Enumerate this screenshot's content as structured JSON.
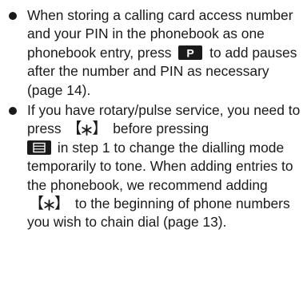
{
  "items": [
    {
      "parts": {
        "a": "When storing a calling card access number and your PIN in the phonebook as one phonebook entry, press",
        "b": "to add pauses after the number and PIN as necessary (page 14)."
      },
      "key_icon": "pause-key-icon",
      "key_label": "P"
    },
    {
      "parts": {
        "a": "If you have rotary/pulse service, you need to press",
        "b": "before pressing",
        "c": "in step 1 to change the dialling mode temporarily to tone. When adding entries to the phonebook, we recommend adding",
        "d": "to the beginning of phone numbers you wish to chain dial (page 13)."
      },
      "key_icons": [
        "star-key-icon",
        "phonebook-key-icon",
        "star-key-icon"
      ]
    }
  ],
  "colors": {
    "text": "#1a1a1a",
    "key_background": "#1a1a1a",
    "key_foreground": "#ffffff"
  }
}
